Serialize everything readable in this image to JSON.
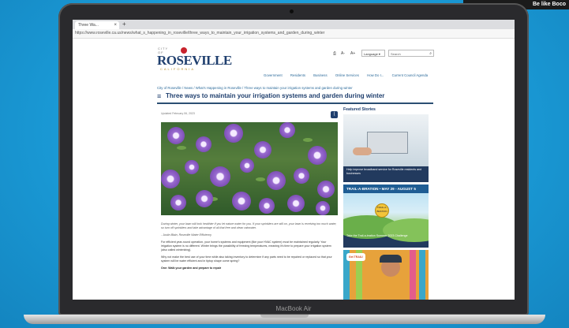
{
  "corner_promo": {
    "text": "Be like Boco"
  },
  "laptop": {
    "brand": "MacBook Air"
  },
  "browser": {
    "tab_title": "Three Wa...",
    "tab_close": "×",
    "new_tab": "+",
    "url": "https://www.roseville.ca.us/news/what_s_happening_in_roseville/three_ways_to_maintain_your_irrigation_systems_and_garden_during_winter"
  },
  "site": {
    "logo_city": "CITY OF",
    "logo_name": "ROSEVILLE",
    "logo_state": "CALIFORNIA",
    "util": {
      "print": "⎙",
      "font_down": "A-",
      "font_up": "A+",
      "language": "Language ▾",
      "search_placeholder": "Search",
      "search_icon": "⌕"
    },
    "nav": [
      "Government",
      "Residents",
      "Business",
      "Online Services",
      "How Do I...",
      "Current Council Agenda"
    ]
  },
  "article": {
    "breadcrumb": "City of Roseville / News / What's Happening in Roseville / Three ways to maintain your irrigation systems and garden during winter",
    "title_icon": "≡",
    "title": "Three ways to maintain your irrigation systems and garden during winter",
    "updated": "Updated February 06, 2023",
    "share_icon": "⟨",
    "quote": "During winter, your lawn will look healthier if you let nature water for you. If your sprinklers are still on, your lawn is receiving too much water, so turn off sprinklers and take advantage of all that free and clean rainwater.",
    "quote_attr": "- Justin Blain, Roseville Water Efficiency",
    "p1": "For efficient year-round operation, your home's systems and equipment (like your HVAC system) must be maintained regularly. Your irrigation system is no different. Winter brings the possibility of freezing temperatures, meaning it's time to prepare your irrigation system (also called winterizing).",
    "p2": "Why not make the best use of your time while also taking inventory to determine if any parts need to be repaired or replaced so that your system will be water efficient and in tiptop shape come spring?",
    "p3_heading": "One: Walk your garden and prepare to repair"
  },
  "sidebar": {
    "heading": "Featured Stories",
    "card1_caption": "Help improve broadband service for Roseville residents and businesses",
    "card2_header": "TRAIL-A-BRATION • MAY 29 - AUGUST 5",
    "card2_badge": "TRAIL-A-BRATION",
    "card2_caption": "Take the Trail-a-bration Summer 2023 Challenge",
    "card3_tag": "Get TRAIL!"
  }
}
